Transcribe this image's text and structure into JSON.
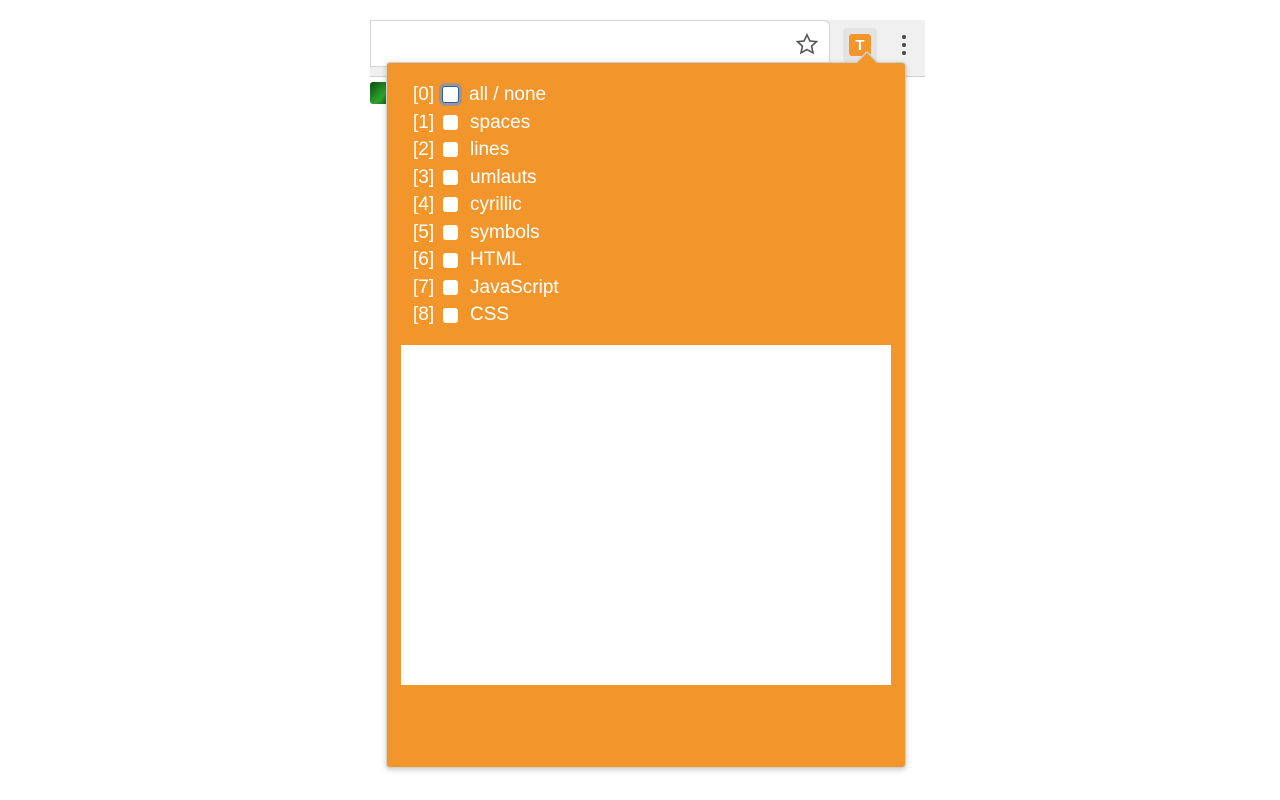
{
  "colors": {
    "accent": "#f2952b"
  },
  "extension_button": {
    "letter": "T"
  },
  "options": [
    {
      "index": "[0]",
      "label": "all / none",
      "checked": false,
      "focused": true
    },
    {
      "index": "[1]",
      "label": "spaces",
      "checked": false,
      "focused": false
    },
    {
      "index": "[2]",
      "label": "lines",
      "checked": false,
      "focused": false
    },
    {
      "index": "[3]",
      "label": "umlauts",
      "checked": false,
      "focused": false
    },
    {
      "index": "[4]",
      "label": "cyrillic",
      "checked": false,
      "focused": false
    },
    {
      "index": "[5]",
      "label": "symbols",
      "checked": false,
      "focused": false
    },
    {
      "index": "[6]",
      "label": "HTML",
      "checked": false,
      "focused": false
    },
    {
      "index": "[7]",
      "label": "JavaScript",
      "checked": false,
      "focused": false
    },
    {
      "index": "[8]",
      "label": "CSS",
      "checked": false,
      "focused": false
    }
  ]
}
